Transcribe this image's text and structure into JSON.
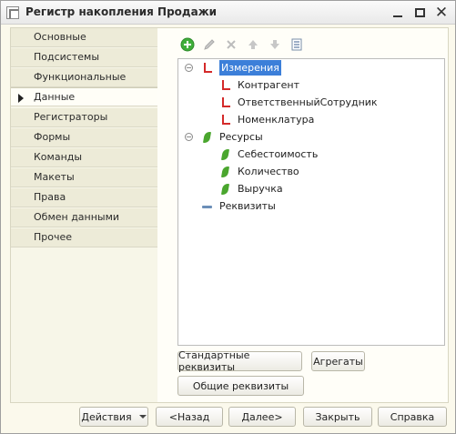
{
  "window": {
    "title": "Регистр накопления Продажи"
  },
  "nav": {
    "items": [
      {
        "label": "Основные"
      },
      {
        "label": "Подсистемы"
      },
      {
        "label": "Функциональные опции"
      },
      {
        "label": "Данные",
        "active": true
      },
      {
        "label": "Регистраторы"
      },
      {
        "label": "Формы"
      },
      {
        "label": "Команды"
      },
      {
        "label": "Макеты"
      },
      {
        "label": "Права"
      },
      {
        "label": "Обмен данными"
      },
      {
        "label": "Прочее"
      }
    ]
  },
  "toolbar": {
    "icons": [
      "add-icon",
      "edit-icon",
      "delete-icon",
      "move-up-icon",
      "move-down-icon",
      "sort-list-icon"
    ]
  },
  "tree": {
    "dimensions": {
      "label": "Измерения",
      "items": [
        {
          "label": "Контрагент"
        },
        {
          "label": "ОтветственныйСотрудник"
        },
        {
          "label": "Номенклатура"
        }
      ]
    },
    "resources": {
      "label": "Ресурсы",
      "items": [
        {
          "label": "Себестоимость"
        },
        {
          "label": "Количество"
        },
        {
          "label": "Выручка"
        }
      ]
    },
    "attributes": {
      "label": "Реквизиты"
    }
  },
  "data_buttons": {
    "standard": "Стандартные реквизиты",
    "aggregates": "Агрегаты",
    "common": "Общие реквизиты"
  },
  "footer": {
    "actions": "Действия",
    "back": "<Назад",
    "next": "Далее>",
    "close": "Закрыть",
    "help": "Справка"
  },
  "colors": {
    "selection": "#3c7fd9",
    "dimension_icon": "#d42a2a",
    "resource_icon": "#4aa62e",
    "add_icon": "#3fae3a"
  }
}
